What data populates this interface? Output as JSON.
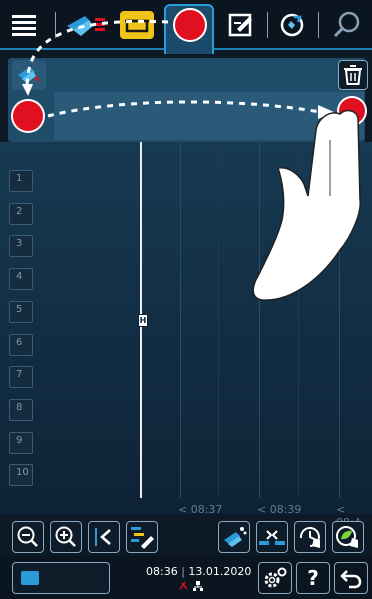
{
  "slots": [
    "1",
    "2",
    "3",
    "4",
    "5",
    "6",
    "7",
    "8",
    "9",
    "10"
  ],
  "time_axis": [
    "< 08:37",
    "< 08:39",
    "< 08:4"
  ],
  "now_marker": "H",
  "status": {
    "time": "08:36",
    "date": "13.01.2020"
  },
  "icons": {
    "menu": "menu-icon",
    "pans": "pans-icon",
    "pots": "pots-icon",
    "pencil": "edit-icon",
    "refresh": "refresh-icon",
    "search": "search-icon",
    "trash": "trash-icon",
    "zoom_out": "zoom-out-icon",
    "zoom_in": "zoom-in-icon",
    "back": "chevron-left-icon",
    "gantt": "gantt-edit-icon",
    "clean": "clean-icon",
    "compress": "compress-icon",
    "timer": "timer-hand-icon",
    "leaf": "leaf-hand-icon",
    "settings": "gear-icon",
    "help": "help-icon",
    "undo": "back-arrow-icon"
  },
  "colors": {
    "accent": "#1e7fb5",
    "red": "#e01020",
    "yellow": "#f0c419"
  },
  "help_label": "?"
}
